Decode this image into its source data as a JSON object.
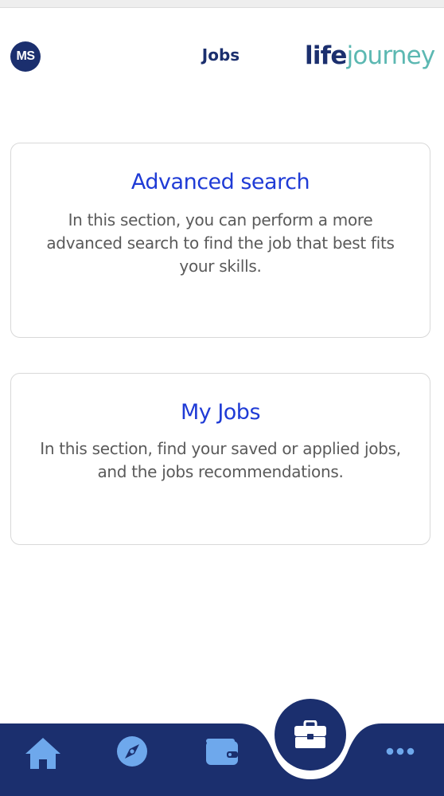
{
  "header": {
    "avatar_initials": "MS",
    "title": "Jobs",
    "logo": {
      "part1": "life",
      "part2": "journey"
    }
  },
  "cards": [
    {
      "title": "Advanced search",
      "description": "In this section, you can perform a more advanced search to find the job that best fits your skills."
    },
    {
      "title": "My Jobs",
      "description": "In this section, find your saved or applied jobs, and the jobs recommendations."
    }
  ],
  "bottom_nav": {
    "items": [
      {
        "icon": "home-icon"
      },
      {
        "icon": "compass-icon"
      },
      {
        "icon": "wallet-icon"
      },
      {
        "icon": "briefcase-icon",
        "active": true
      },
      {
        "icon": "more-dots-icon"
      }
    ]
  },
  "colors": {
    "primary_navy": "#1b2f6e",
    "accent_teal": "#5cb8b2",
    "link_blue": "#1f3bd6",
    "nav_icon_light_blue": "#6ea8ec",
    "text_gray": "#5a5a5a"
  }
}
